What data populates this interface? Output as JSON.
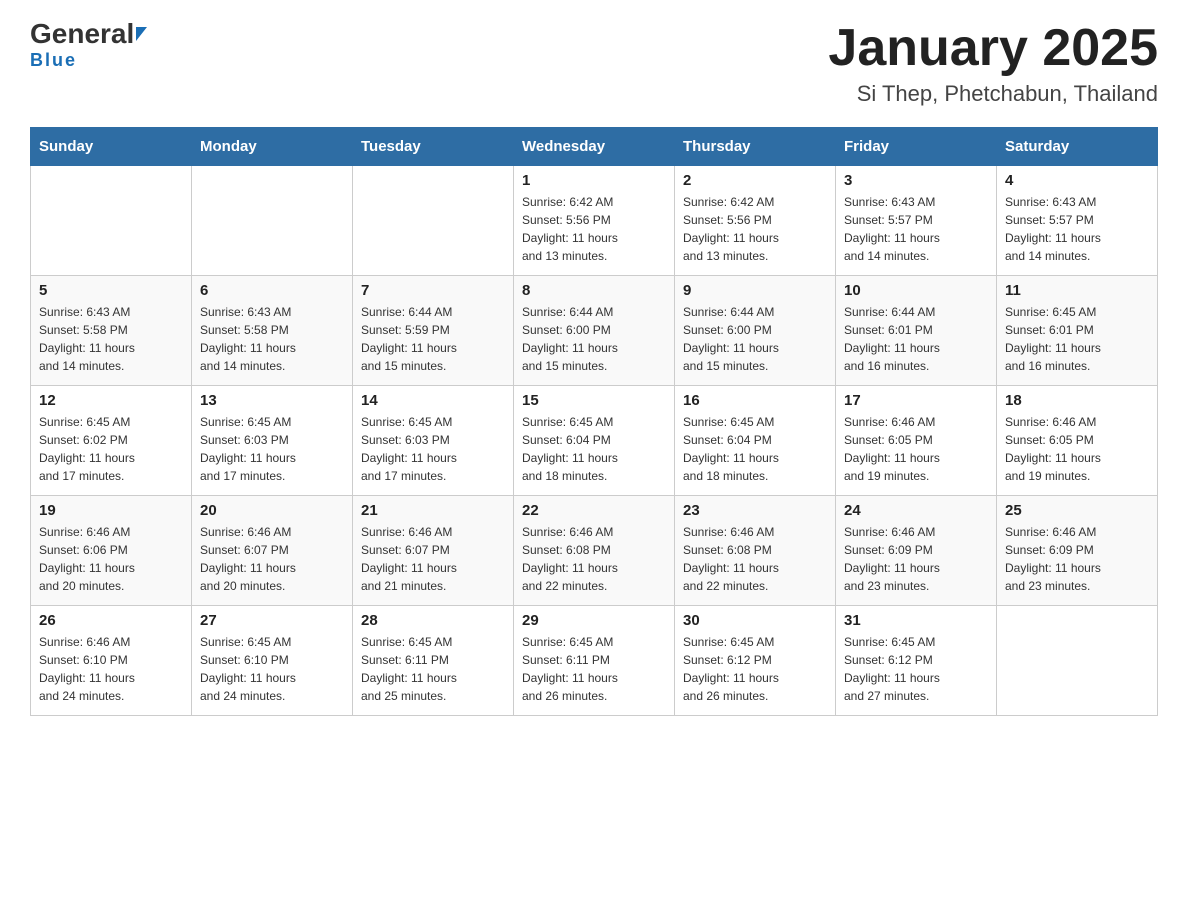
{
  "header": {
    "logo_general": "General",
    "logo_blue": "Blue",
    "title": "January 2025",
    "subtitle": "Si Thep, Phetchabun, Thailand"
  },
  "days_of_week": [
    "Sunday",
    "Monday",
    "Tuesday",
    "Wednesday",
    "Thursday",
    "Friday",
    "Saturday"
  ],
  "weeks": [
    [
      {
        "day": "",
        "info": ""
      },
      {
        "day": "",
        "info": ""
      },
      {
        "day": "",
        "info": ""
      },
      {
        "day": "1",
        "info": "Sunrise: 6:42 AM\nSunset: 5:56 PM\nDaylight: 11 hours\nand 13 minutes."
      },
      {
        "day": "2",
        "info": "Sunrise: 6:42 AM\nSunset: 5:56 PM\nDaylight: 11 hours\nand 13 minutes."
      },
      {
        "day": "3",
        "info": "Sunrise: 6:43 AM\nSunset: 5:57 PM\nDaylight: 11 hours\nand 14 minutes."
      },
      {
        "day": "4",
        "info": "Sunrise: 6:43 AM\nSunset: 5:57 PM\nDaylight: 11 hours\nand 14 minutes."
      }
    ],
    [
      {
        "day": "5",
        "info": "Sunrise: 6:43 AM\nSunset: 5:58 PM\nDaylight: 11 hours\nand 14 minutes."
      },
      {
        "day": "6",
        "info": "Sunrise: 6:43 AM\nSunset: 5:58 PM\nDaylight: 11 hours\nand 14 minutes."
      },
      {
        "day": "7",
        "info": "Sunrise: 6:44 AM\nSunset: 5:59 PM\nDaylight: 11 hours\nand 15 minutes."
      },
      {
        "day": "8",
        "info": "Sunrise: 6:44 AM\nSunset: 6:00 PM\nDaylight: 11 hours\nand 15 minutes."
      },
      {
        "day": "9",
        "info": "Sunrise: 6:44 AM\nSunset: 6:00 PM\nDaylight: 11 hours\nand 15 minutes."
      },
      {
        "day": "10",
        "info": "Sunrise: 6:44 AM\nSunset: 6:01 PM\nDaylight: 11 hours\nand 16 minutes."
      },
      {
        "day": "11",
        "info": "Sunrise: 6:45 AM\nSunset: 6:01 PM\nDaylight: 11 hours\nand 16 minutes."
      }
    ],
    [
      {
        "day": "12",
        "info": "Sunrise: 6:45 AM\nSunset: 6:02 PM\nDaylight: 11 hours\nand 17 minutes."
      },
      {
        "day": "13",
        "info": "Sunrise: 6:45 AM\nSunset: 6:03 PM\nDaylight: 11 hours\nand 17 minutes."
      },
      {
        "day": "14",
        "info": "Sunrise: 6:45 AM\nSunset: 6:03 PM\nDaylight: 11 hours\nand 17 minutes."
      },
      {
        "day": "15",
        "info": "Sunrise: 6:45 AM\nSunset: 6:04 PM\nDaylight: 11 hours\nand 18 minutes."
      },
      {
        "day": "16",
        "info": "Sunrise: 6:45 AM\nSunset: 6:04 PM\nDaylight: 11 hours\nand 18 minutes."
      },
      {
        "day": "17",
        "info": "Sunrise: 6:46 AM\nSunset: 6:05 PM\nDaylight: 11 hours\nand 19 minutes."
      },
      {
        "day": "18",
        "info": "Sunrise: 6:46 AM\nSunset: 6:05 PM\nDaylight: 11 hours\nand 19 minutes."
      }
    ],
    [
      {
        "day": "19",
        "info": "Sunrise: 6:46 AM\nSunset: 6:06 PM\nDaylight: 11 hours\nand 20 minutes."
      },
      {
        "day": "20",
        "info": "Sunrise: 6:46 AM\nSunset: 6:07 PM\nDaylight: 11 hours\nand 20 minutes."
      },
      {
        "day": "21",
        "info": "Sunrise: 6:46 AM\nSunset: 6:07 PM\nDaylight: 11 hours\nand 21 minutes."
      },
      {
        "day": "22",
        "info": "Sunrise: 6:46 AM\nSunset: 6:08 PM\nDaylight: 11 hours\nand 22 minutes."
      },
      {
        "day": "23",
        "info": "Sunrise: 6:46 AM\nSunset: 6:08 PM\nDaylight: 11 hours\nand 22 minutes."
      },
      {
        "day": "24",
        "info": "Sunrise: 6:46 AM\nSunset: 6:09 PM\nDaylight: 11 hours\nand 23 minutes."
      },
      {
        "day": "25",
        "info": "Sunrise: 6:46 AM\nSunset: 6:09 PM\nDaylight: 11 hours\nand 23 minutes."
      }
    ],
    [
      {
        "day": "26",
        "info": "Sunrise: 6:46 AM\nSunset: 6:10 PM\nDaylight: 11 hours\nand 24 minutes."
      },
      {
        "day": "27",
        "info": "Sunrise: 6:45 AM\nSunset: 6:10 PM\nDaylight: 11 hours\nand 24 minutes."
      },
      {
        "day": "28",
        "info": "Sunrise: 6:45 AM\nSunset: 6:11 PM\nDaylight: 11 hours\nand 25 minutes."
      },
      {
        "day": "29",
        "info": "Sunrise: 6:45 AM\nSunset: 6:11 PM\nDaylight: 11 hours\nand 26 minutes."
      },
      {
        "day": "30",
        "info": "Sunrise: 6:45 AM\nSunset: 6:12 PM\nDaylight: 11 hours\nand 26 minutes."
      },
      {
        "day": "31",
        "info": "Sunrise: 6:45 AM\nSunset: 6:12 PM\nDaylight: 11 hours\nand 27 minutes."
      },
      {
        "day": "",
        "info": ""
      }
    ]
  ]
}
